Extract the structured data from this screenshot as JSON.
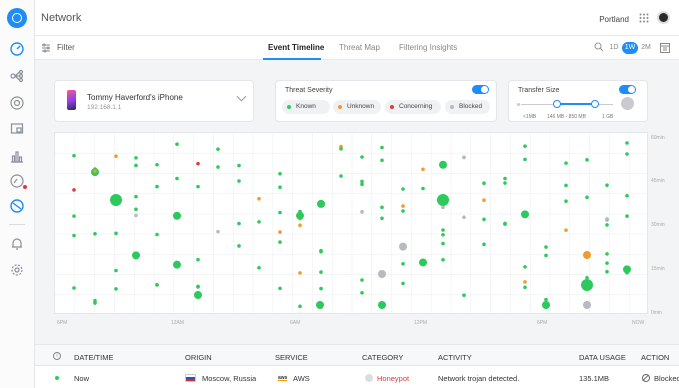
{
  "app": {
    "title": "Network"
  },
  "header": {
    "site": "Portland"
  },
  "sidebar": {
    "items": [
      {
        "name": "dashboard",
        "icon": "gauge-icon",
        "active": true
      },
      {
        "name": "topology",
        "icon": "topology-icon"
      },
      {
        "name": "devices",
        "icon": "devices-icon"
      },
      {
        "name": "clients",
        "icon": "clients-icon"
      },
      {
        "name": "statistics",
        "icon": "stats-icon"
      },
      {
        "name": "insights",
        "icon": "insights-icon"
      },
      {
        "name": "security",
        "icon": "shield-icon",
        "active": true
      },
      {
        "name": "alerts",
        "icon": "bell-icon"
      },
      {
        "name": "settings",
        "icon": "gear-icon"
      }
    ]
  },
  "toolbar": {
    "filter_label": "Filter",
    "tabs": [
      {
        "label": "Event Timeline",
        "active": true
      },
      {
        "label": "Threat Map"
      },
      {
        "label": "Filtering Insights"
      }
    ],
    "ranges": [
      "1D",
      "1W",
      "2M"
    ],
    "active_range": "1W"
  },
  "device": {
    "name": "Tommy Haverford's iPhone",
    "ip": "192.168.1.1"
  },
  "severity": {
    "title": "Threat Severity",
    "enabled": true,
    "levels": [
      {
        "label": "Known",
        "color": "#2ec95c"
      },
      {
        "label": "Unknown",
        "color": "#f29a2e"
      },
      {
        "label": "Concerning",
        "color": "#e23a3a"
      },
      {
        "label": "Blocked",
        "color": "#b8bac0"
      }
    ]
  },
  "transfer": {
    "title": "Transfer Size",
    "enabled": true,
    "min_label": "<1MB",
    "range_label": "146 MB - 850 MB",
    "max_label": "1 GB"
  },
  "chart_data": {
    "type": "scatter",
    "y_labels": [
      "60min",
      "45min",
      "30min",
      "15min",
      "0min"
    ],
    "x_labels": [
      "6PM",
      "12AM",
      "6AM",
      "12PM",
      "6PM",
      "NOW"
    ],
    "grid": true
  },
  "table": {
    "columns": [
      "DATE/TIME",
      "ORIGIN",
      "SERVICE",
      "CATEGORY",
      "ACTIVITY",
      "DATA USAGE",
      "ACTION"
    ],
    "rows": [
      {
        "time": "Now",
        "origin": "Moscow, Russia",
        "service": "AWS",
        "category": "Honeypot",
        "activity": "Network trojan detected.",
        "usage": "135.1MB",
        "action": "Blocked"
      }
    ]
  }
}
